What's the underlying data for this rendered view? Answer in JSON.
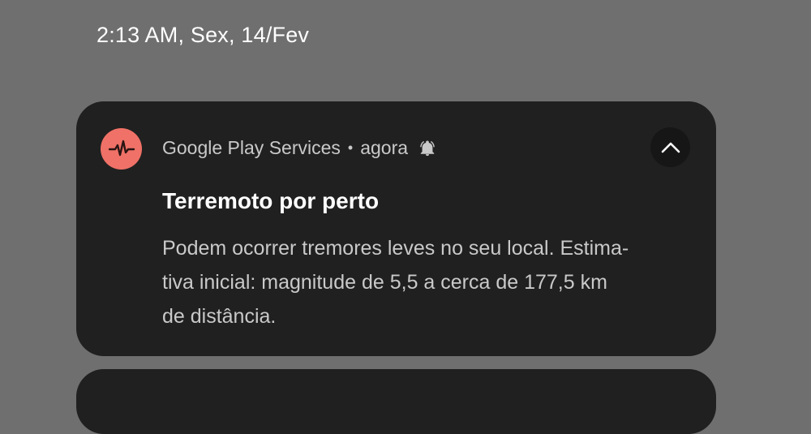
{
  "status": {
    "datetime": "2:13 AM, Sex, 14/Fev"
  },
  "notification": {
    "app_name": "Google Play Services",
    "separator": "•",
    "time": "agora",
    "title": "Terremoto por perto",
    "body_lines": [
      "Podem ocorrer tremores leves no seu local. Estima-",
      "tiva inicial: magnitude de 5,5 a cerca de 177,5 km",
      "de distância."
    ],
    "icons": {
      "app": "heartbeat-pulse-icon",
      "alert": "bell-icon",
      "collapse": "chevron-up-icon"
    },
    "colors": {
      "app_icon_bg": "#f07167",
      "card_bg": "#202020",
      "page_bg": "#6f6f6f"
    }
  }
}
